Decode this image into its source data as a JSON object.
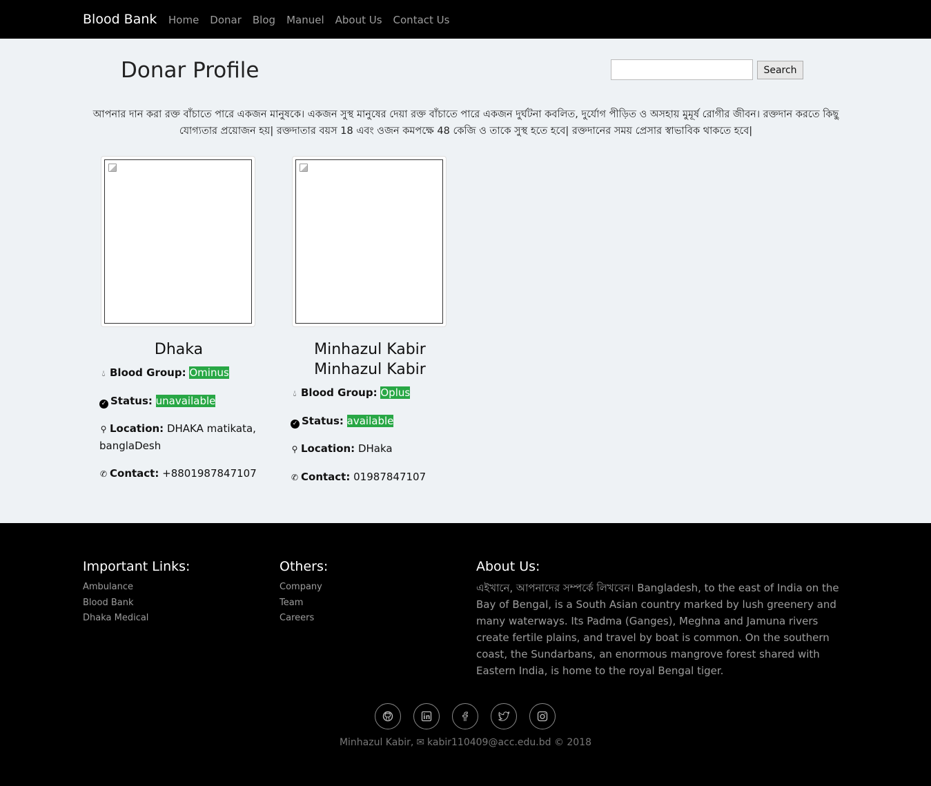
{
  "navbar": {
    "brand": "Blood Bank",
    "links": [
      "Home",
      "Donar",
      "Blog",
      "Manuel",
      "About Us",
      "Contact Us"
    ]
  },
  "page": {
    "title": "Donar Profile",
    "search_button": "Search",
    "search_value": "",
    "intro": "আপনার দান করা রক্ত বাঁচাতে পারে একজন মানুষকে। একজন সুস্থ মানুষের দেয়া রক্ত বাঁচাতে পারে একজন দুর্ঘটনা কবলিত, দুর্যোগ পীড়িত ও অসহায় মুমূর্ষ রোগীর জীবন। রক্তদান করতে কিছু যোগ্যতার প্রয়োজন হয়| রক্তদাতার বয়স 18 এবং ওজন কমপক্ষে 48 কেজি ও তাকে সুস্থ হতে হবে| রক্তদানের সময় প্রেসার স্বাভাবিক থাকতে হবে|"
  },
  "labels": {
    "blood_group": "Blood Group:",
    "status": "Status:",
    "location": "Location:",
    "contact": "Contact:"
  },
  "donors": [
    {
      "name": "Dhaka",
      "blood_group": "Ominus",
      "status": "unavailable",
      "location": "DHAKA matikata, banglaDesh",
      "contact": "+8801987847107"
    },
    {
      "name": "Minhazul Kabir Minhazul Kabir",
      "blood_group": "Oplus",
      "status": "available",
      "location": "DHaka",
      "contact": "01987847107"
    }
  ],
  "footer": {
    "important_links": {
      "title": "Important Links:",
      "items": [
        "Ambulance",
        "Blood Bank",
        "Dhaka Medical"
      ]
    },
    "others": {
      "title": "Others:",
      "items": [
        "Company",
        "Team",
        "Careers"
      ]
    },
    "about": {
      "title": "About Us:",
      "text": "এইখানে, আপনাদের সম্পর্কে লিখবেন। Bangladesh, to the east of India on the Bay of Bengal, is a South Asian country marked by lush greenery and many waterways. Its Padma (Ganges), Meghna and Jamuna rivers create fertile plains, and travel by boat is common. On the southern coast, the Sundarbans, an enormous mangrove forest shared with Eastern India, is home to the royal Bengal tiger."
    },
    "socials": [
      "github-icon",
      "linkedin-icon",
      "facebook-icon",
      "twitter-icon",
      "instagram-icon"
    ],
    "copyright_name": "Minhazul Kabir,",
    "copyright_email": "kabir110409@acc.edu.bd",
    "copyright_year": "© 2018"
  }
}
